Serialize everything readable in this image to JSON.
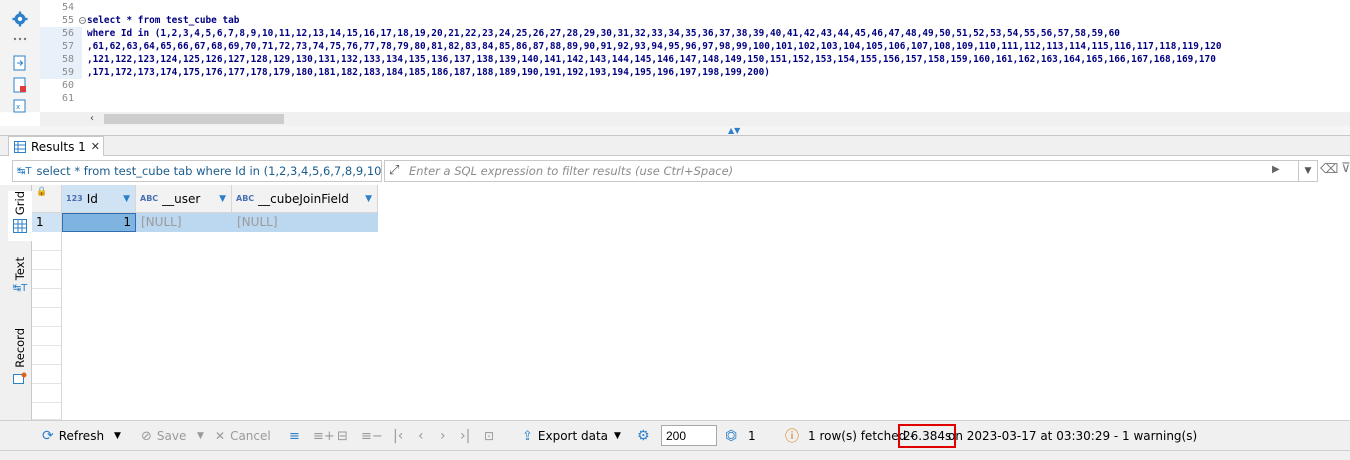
{
  "editor": {
    "line_numbers": [
      "54",
      "55",
      "56",
      "57",
      "58",
      "59",
      "60",
      "61"
    ],
    "sql_line1_kw": "select * from test_cube tab",
    "sql_line2": "where Id in (1,2,3,4,5,6,7,8,9,10,11,12,13,14,15,16,17,18,19,20,21,22,23,24,25,26,27,28,29,30,31,32,33,34,35,36,37,38,39,40,41,42,43,44,45,46,47,48,49,50,51,52,53,54,55,56,57,58,59,60",
    "sql_line3": ",61,62,63,64,65,66,67,68,69,70,71,72,73,74,75,76,77,78,79,80,81,82,83,84,85,86,87,88,89,90,91,92,93,94,95,96,97,98,99,100,101,102,103,104,105,106,107,108,109,110,111,112,113,114,115,116,117,118,119,120",
    "sql_line4": ",121,122,123,124,125,126,127,128,129,130,131,132,133,134,135,136,137,138,139,140,141,142,143,144,145,146,147,148,149,150,151,152,153,154,155,156,157,158,159,160,161,162,163,164,165,166,167,168,169,170",
    "sql_line5": ",171,172,173,174,175,176,177,178,179,180,181,182,183,184,185,186,187,188,189,190,191,192,193,194,195,196,197,198,199,200)"
  },
  "results": {
    "tab_label": "Results 1",
    "query_text": "select * from test_cube tab where Id in (1,2,3,4,5,6,7,8,9,10,11,12,13,14,15,16",
    "filter_placeholder": "Enter a SQL expression to filter results (use Ctrl+Space)",
    "side_tabs": [
      "Grid",
      "Text",
      "Record"
    ],
    "columns": [
      {
        "type": "123",
        "name": "Id"
      },
      {
        "type": "ABC",
        "name": "__user"
      },
      {
        "type": "ABC",
        "name": "__cubeJoinField"
      }
    ],
    "rows": [
      {
        "num": "1",
        "cells": [
          "1",
          "[NULL]",
          "[NULL]"
        ]
      }
    ]
  },
  "toolbar": {
    "refresh": "Refresh",
    "save": "Save",
    "cancel": "Cancel",
    "export": "Export data",
    "fetch_size": "200",
    "row_count": "1",
    "status_fetched": "1 row(s) fetched -",
    "duration": "26.384s",
    "status_tail": "on 2023-03-17 at 03:30:29 - 1 warning(s)"
  },
  "colors": {
    "accent": "#1e88d2",
    "selection": "#bcd7f0",
    "highlight_border": "#e00000"
  }
}
